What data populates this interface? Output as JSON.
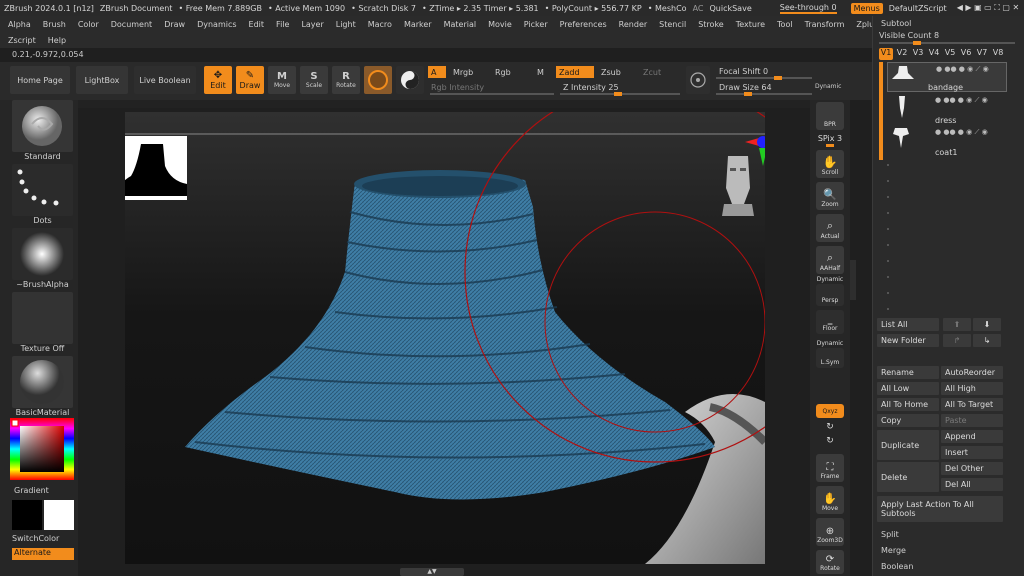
{
  "titlebar": {
    "app": "ZBrush 2024.0.1 [n1z]",
    "document": "ZBrush Document",
    "free_mem": "• Free Mem 7.889GB",
    "active_mem": "• Active Mem 1090",
    "scratch": "• Scratch Disk 7",
    "ztime": "• ZTime ▸ 2.35 Timer ▸ 5.381",
    "polycount": "• PolyCount ▸ 556.77 KP",
    "meshco": "• MeshCo",
    "ac": "AC",
    "quicksave": "QuickSave",
    "see_through": "See-through  0",
    "menus": "Menus",
    "script": "DefaultZScript"
  },
  "menu": {
    "row1": [
      "Alpha",
      "Brush",
      "Color",
      "Document",
      "Draw",
      "Dynamics",
      "Edit",
      "File",
      "Layer",
      "Light",
      "Macro",
      "Marker",
      "Material",
      "Movie",
      "Picker",
      "Preferences",
      "Render",
      "Stencil",
      "Stroke",
      "Texture",
      "Tool",
      "Transform",
      "Zplugin"
    ],
    "row2": [
      "Zscript",
      "Help"
    ]
  },
  "coords": "0.21,-0.972,0.054",
  "toolbar": {
    "home_page": "Home Page",
    "lightbox": "LightBox",
    "live_boolean": "Live Boolean",
    "edit": "Edit",
    "draw": "Draw",
    "move": "Move",
    "scale": "Scale",
    "rotate": "Rotate",
    "a": "A",
    "mrgb": "Mrgb",
    "rgb": "Rgb",
    "m": "M",
    "zadd": "Zadd",
    "zsub": "Zsub",
    "zcut": "Zcut",
    "rgb_intensity": "Rgb Intensity",
    "z_intensity": "Z Intensity 25",
    "focal_shift": "Focal Shift 0",
    "draw_size": "Draw Size 64",
    "dynamic": "Dynamic"
  },
  "leftpanel": {
    "standard": "Standard",
    "dots": "Dots",
    "brush_alpha": "~BrushAlpha",
    "texture_off": "Texture Off",
    "basic_material": "BasicMaterial",
    "gradient": "Gradient",
    "switch_color": "SwitchColor",
    "alternate": "Alternate"
  },
  "rightcol": {
    "bpr": "BPR",
    "spix": "SPix 3",
    "scroll": "Scroll",
    "zoom": "Zoom",
    "actual": "Actual",
    "aahalf": "AAHalf",
    "dynamic1": "Dynamic",
    "persp": "Persp",
    "floor": "Floor",
    "dynamic2": "Dynamic",
    "lsym": "L.Sym",
    "xyz": "Qxyz",
    "frame": "Frame",
    "move": "Move",
    "zoom3d": "Zoom3D",
    "rotate": "Rotate"
  },
  "subtool": {
    "title": "Subtool",
    "visible_count": "Visible Count 8",
    "versions": [
      "V1",
      "V2",
      "V3",
      "V4",
      "V5",
      "V6",
      "V7",
      "V8"
    ],
    "items": [
      "bandage",
      "dress",
      "coat1"
    ],
    "list_all": "List All",
    "new_folder": "New Folder",
    "rename": "Rename",
    "auto_reorder": "AutoReorder",
    "all_low": "All Low",
    "all_high": "All High",
    "all_to_home": "All To Home",
    "all_to_target": "All To Target",
    "copy": "Copy",
    "paste": "Paste",
    "duplicate": "Duplicate",
    "append": "Append",
    "insert": "Insert",
    "delete": "Delete",
    "del_other": "Del Other",
    "del_all": "Del All",
    "apply_last": "Apply Last Action To All Subtools",
    "split": "Split",
    "merge": "Merge",
    "boolean": "Boolean"
  },
  "colors": {
    "accent": "#f28c1c",
    "mesh": "#3f7ea6",
    "panel": "#2b2b2b"
  }
}
